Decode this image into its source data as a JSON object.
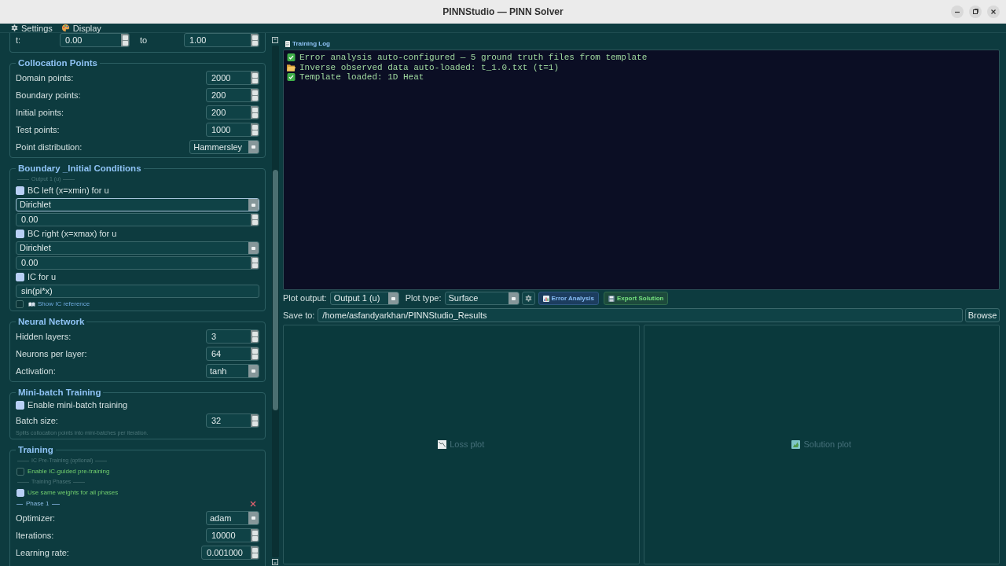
{
  "window": {
    "title": "PINNStudio — PINN Solver"
  },
  "menu": {
    "settings": "Settings",
    "display": "Display"
  },
  "settings_panel": {
    "groups": [
      {
        "rows": [
          {
            "kind": "range",
            "label": "t:",
            "from": "0.00",
            "joiner": "to",
            "to": "1.00"
          }
        ]
      },
      {
        "title": "Collocation Points",
        "rows": [
          {
            "kind": "spin",
            "label": "Domain points:",
            "value": "2000"
          },
          {
            "kind": "spin",
            "label": "Boundary points:",
            "value": "200"
          },
          {
            "kind": "spin",
            "label": "Initial points:",
            "value": "200"
          },
          {
            "kind": "spin",
            "label": "Test points:",
            "value": "1000"
          },
          {
            "kind": "combo",
            "label": "Point distribution:",
            "value": "Hammersley"
          }
        ]
      },
      {
        "title": "Boundary _Initial Conditions",
        "rows": [
          {
            "kind": "caption",
            "text": "Output 1 (u)"
          },
          {
            "kind": "check",
            "label": "BC left (x=xmin) for u",
            "checked": true
          },
          {
            "kind": "widecombo",
            "value": "Dirichlet",
            "focused": true
          },
          {
            "kind": "widespin",
            "value": "0.00"
          },
          {
            "kind": "check",
            "label": "BC right (x=xmax) for u",
            "checked": true
          },
          {
            "kind": "widecombo",
            "value": "Dirichlet",
            "focused": false
          },
          {
            "kind": "widespin",
            "value": "0.00"
          },
          {
            "kind": "check",
            "label": "IC for u",
            "checked": true
          },
          {
            "kind": "edit",
            "value": "sin(pi*x)"
          },
          {
            "kind": "refcheck",
            "label": "Show IC reference",
            "checked": false
          }
        ]
      },
      {
        "title": "Neural Network",
        "rows": [
          {
            "kind": "spin",
            "label": "Hidden layers:",
            "value": "3"
          },
          {
            "kind": "spin",
            "label": "Neurons per layer:",
            "value": "64"
          },
          {
            "kind": "combo",
            "label": "Activation:",
            "value": "tanh"
          }
        ]
      },
      {
        "title": "Mini-batch Training",
        "rows": [
          {
            "kind": "check",
            "label": "Enable mini-batch training",
            "checked": true
          },
          {
            "kind": "spin",
            "label": "Batch size:",
            "value": "32"
          },
          {
            "kind": "hint",
            "text": "Splits collocation points into mini-batches per iteration."
          }
        ]
      },
      {
        "title": "Training",
        "rows": [
          {
            "kind": "caption",
            "text": "IC Pre-Training (optional)"
          },
          {
            "kind": "optcheck",
            "label": "Enable IC-guided pre-training",
            "checked": false
          },
          {
            "kind": "caption",
            "text": "Training Phases"
          },
          {
            "kind": "optcheck",
            "label": "Use same weights for all phases",
            "checked": true
          },
          {
            "kind": "phase",
            "text": "Phase 1"
          },
          {
            "kind": "combo",
            "label": "Optimizer:",
            "value": "adam"
          },
          {
            "kind": "spin",
            "label": "Iterations:",
            "value": "10000"
          },
          {
            "kind": "spin",
            "label": "Learning rate:",
            "value": "0.001000"
          }
        ]
      }
    ]
  },
  "log": {
    "title": "Training Log",
    "lines": [
      {
        "kind": "success",
        "text": "Error analysis auto-configured — 5 ground truth files from template"
      },
      {
        "kind": "file",
        "text": "Inverse observed data auto-loaded: t_1.0.txt (t=1)"
      },
      {
        "kind": "success",
        "text": "Template loaded: 1D Heat"
      }
    ]
  },
  "plot_controls": {
    "output_label": "Plot output:",
    "output": "Output 1 (u)",
    "type_label": "Plot type:",
    "type": "Surface",
    "error_analysis": "Error Analysis",
    "export": "Export Solution"
  },
  "save": {
    "label": "Save to:",
    "path": "/home/asfandyarkhan/PINNStudio_Results",
    "button": "Browse"
  },
  "plots": {
    "loss": "Loss plot",
    "solution": "Solution plot"
  }
}
